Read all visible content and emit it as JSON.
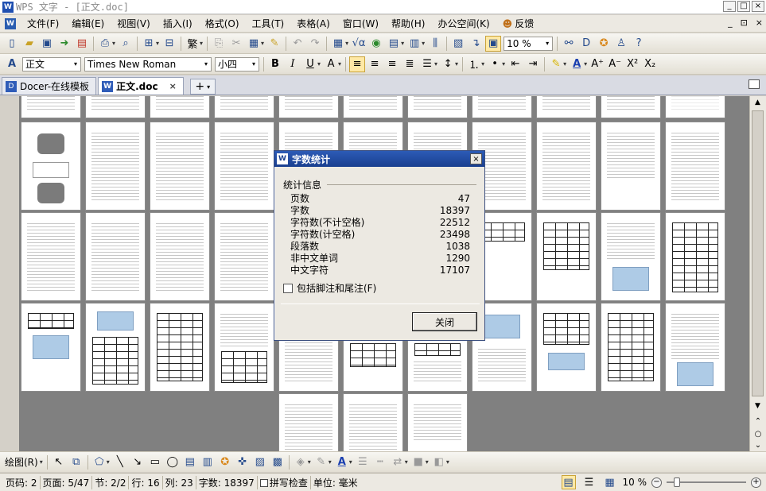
{
  "window": {
    "title": "WPS 文字 - [正文.doc]",
    "logo": "W",
    "controls": [
      "_",
      "□",
      "×"
    ]
  },
  "menu": {
    "items": [
      "文件(F)",
      "编辑(E)",
      "视图(V)",
      "插入(I)",
      "格式(O)",
      "工具(T)",
      "表格(A)",
      "窗口(W)",
      "帮助(H)",
      "办公空间(K)"
    ],
    "feedback": "反馈",
    "right_controls": [
      "_",
      "⊡",
      "×"
    ]
  },
  "toolbar1": {
    "zoom": "10 %"
  },
  "toolbar2": {
    "style": "正文",
    "font": "Times New Roman",
    "size": "小四",
    "bold": "B",
    "italic": "I",
    "underline": "U",
    "font_color": "A",
    "superscript": "X²",
    "subscript": "X₂"
  },
  "tabs": [
    {
      "label": "Docer-在线模板",
      "active": false
    },
    {
      "label": "正文.doc",
      "active": true
    }
  ],
  "dialog": {
    "title": "字数统计",
    "group": "统计信息",
    "stats": [
      {
        "label": "页数",
        "value": "47"
      },
      {
        "label": "字数",
        "value": "18397"
      },
      {
        "label": "字符数(不计空格)",
        "value": "22512"
      },
      {
        "label": "字符数(计空格)",
        "value": "23498"
      },
      {
        "label": "段落数",
        "value": "1038"
      },
      {
        "label": "非中文单词",
        "value": "1290"
      },
      {
        "label": "中文字符",
        "value": "17107"
      }
    ],
    "checkbox_label": "包括脚注和尾注(F)",
    "checkbox_checked": false,
    "close_label": "关闭"
  },
  "drawbar": {
    "draw_label": "绘图(R)"
  },
  "status": {
    "page_no": "页码: 2",
    "page_of": "页面: 5/47",
    "section": "节: 2/2",
    "row": "行: 16",
    "col": "列: 23",
    "words": "字数: 18397",
    "spell": "拼写检查",
    "unit": "单位: 毫米",
    "zoom": "10 %",
    "zoom_fraction": 0.1
  }
}
